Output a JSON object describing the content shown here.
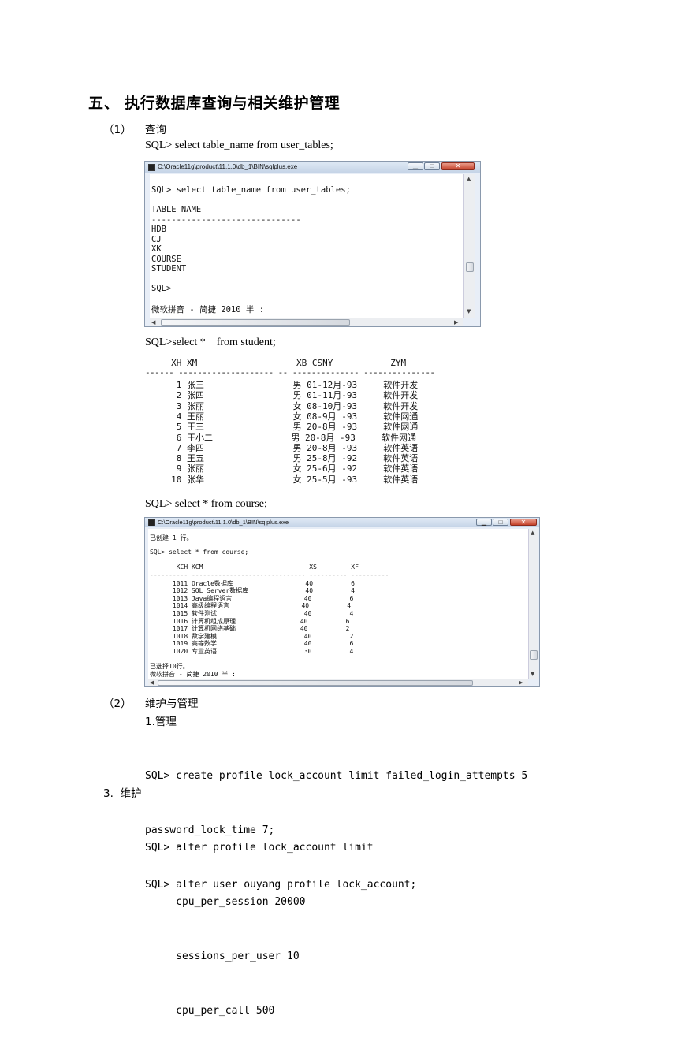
{
  "heading": "五、  执行数据库查询与相关维护管理",
  "section1": {
    "num": "（1）",
    "label": "查询"
  },
  "query1": "SQL> select table_name from user_tables;",
  "window1": {
    "title": "C:\\Oracle11g\\product\\11.1.0\\db_1\\BIN\\sqlplus.exe",
    "lines": [
      "SQL> select table_name from user_tables;",
      "",
      "TABLE_NAME",
      "------------------------------",
      "HDB",
      "CJ",
      "XK",
      "COURSE",
      "STUDENT",
      "",
      "SQL>",
      "",
      "微软拼音 - 简捷 2010 半 :"
    ]
  },
  "query2": "SQL>select *    from student;",
  "student_table": {
    "header": "     XH XM                   XB CSNY           ZYM",
    "rule": "------ -------------------- -- -------------- ---------------",
    "rows": [
      "      1 张三                 男 01-12月-93     软件开发",
      "      2 张四                 男 01-11月-93     软件开发",
      "      3 张丽                 女 08-10月-93     软件开发",
      "      4 王丽                 女 08-9月 -93     软件网通",
      "      5 王三                 男 20-8月 -93     软件网通",
      "      6 王小二               男 20-8月 -93     软件网通",
      "      7 李四                 男 20-8月 -93     软件英语",
      "      8 王五                 男 25-8月 -92     软件英语",
      "      9 张丽                 女 25-6月 -92     软件英语",
      "     10 张华                 女 25-5月 -93     软件英语"
    ]
  },
  "query3": "SQL> select * from course;",
  "window2": {
    "title": "C:\\Oracle11g\\product\\11.1.0\\db_1\\BIN\\sqlplus.exe",
    "lines": [
      "已创建 1 行。",
      "",
      "SQL> select * from course;",
      "",
      "       KCH KCM                            XS         XF",
      "---------- ------------------------------ ---------- ----------",
      "      1011 Oracle数据库                   40          6",
      "      1012 SQL Server数据库               40          4",
      "      1013 Java编程语言                   40          6",
      "      1014 高级编程语言                   40          4",
      "      1015 软件测试                       40          4",
      "      1016 计算机组成原理                 40          6",
      "      1017 计算机网络基础                 40          2",
      "      1018 数学建模                       40          2",
      "      1019 高等数学                       40          6",
      "      1020 专业英语                       30          4",
      "",
      "已选择10行。",
      "微软拼音 - 简捷 2010 半 :"
    ]
  },
  "section2": {
    "num": "（2）",
    "label": "维护与管理"
  },
  "manage_title": "1.管理",
  "manage_lines": [
    "SQL> create profile lock_account limit failed_login_attempts 5",
    "password_lock_time 7;",
    "SQL> alter user ouyang profile lock_account;"
  ],
  "maintain_title": "3.  维护",
  "maintain_lines": [
    "SQL> alter profile lock_account limit",
    "     cpu_per_session 20000",
    "     sessions_per_user 10",
    "     cpu_per_call 500"
  ]
}
